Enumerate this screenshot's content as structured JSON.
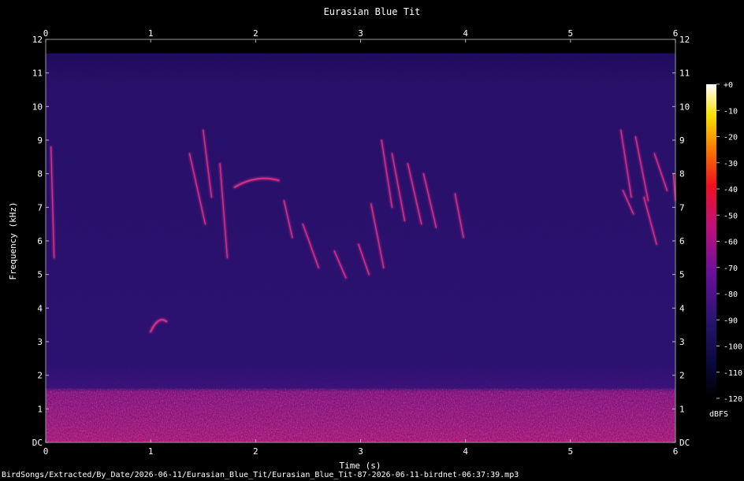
{
  "chart_data": {
    "type": "heatmap",
    "title": "Eurasian Blue Tit",
    "xlabel": "Time (s)",
    "ylabel": "Frequency (kHz)",
    "xlim": [
      0,
      6
    ],
    "ylim": [
      0,
      12
    ],
    "x_ticks": [
      "0",
      "1",
      "2",
      "3",
      "4",
      "5",
      "6"
    ],
    "y_ticks": [
      "DC",
      "1",
      "2",
      "3",
      "4",
      "5",
      "6",
      "7",
      "8",
      "9",
      "10",
      "11",
      "12"
    ],
    "colorbar": {
      "label": "dBFS",
      "range": [
        -120,
        0
      ],
      "ticks": [
        "+0",
        "-10",
        "-20",
        "-30",
        "-40",
        "-50",
        "-60",
        "-70",
        "-80",
        "-90",
        "-100",
        "-110",
        "-120"
      ]
    },
    "colors": {
      "background": "#000000",
      "noise_floor": "#2a1470",
      "low_band": "#c0207a",
      "call": "#e0308a"
    },
    "low_band_khz": [
      0,
      1.6
    ],
    "calls": [
      {
        "t0": 0.05,
        "t1": 0.08,
        "f0": 8.8,
        "f1": 5.5
      },
      {
        "t0": 1.0,
        "t1": 1.15,
        "f0": 3.3,
        "f1": 3.6
      },
      {
        "t0": 1.37,
        "t1": 1.52,
        "f0": 8.6,
        "f1": 6.5
      },
      {
        "t0": 1.5,
        "t1": 1.58,
        "f0": 9.3,
        "f1": 7.3
      },
      {
        "t0": 1.66,
        "t1": 1.73,
        "f0": 8.3,
        "f1": 5.5
      },
      {
        "t0": 1.8,
        "t1": 2.22,
        "f0": 7.6,
        "f1": 7.8
      },
      {
        "t0": 2.27,
        "t1": 2.35,
        "f0": 7.2,
        "f1": 6.1
      },
      {
        "t0": 2.45,
        "t1": 2.6,
        "f0": 6.5,
        "f1": 5.2
      },
      {
        "t0": 2.75,
        "t1": 2.86,
        "f0": 5.7,
        "f1": 4.9
      },
      {
        "t0": 2.98,
        "t1": 3.08,
        "f0": 5.9,
        "f1": 5.0
      },
      {
        "t0": 3.1,
        "t1": 3.22,
        "f0": 7.1,
        "f1": 5.2
      },
      {
        "t0": 3.2,
        "t1": 3.3,
        "f0": 9.0,
        "f1": 7.0
      },
      {
        "t0": 3.3,
        "t1": 3.42,
        "f0": 8.6,
        "f1": 6.6
      },
      {
        "t0": 3.45,
        "t1": 3.58,
        "f0": 8.3,
        "f1": 6.5
      },
      {
        "t0": 3.6,
        "t1": 3.72,
        "f0": 8.0,
        "f1": 6.4
      },
      {
        "t0": 3.9,
        "t1": 3.98,
        "f0": 7.4,
        "f1": 6.1
      },
      {
        "t0": 5.48,
        "t1": 5.58,
        "f0": 9.3,
        "f1": 7.3
      },
      {
        "t0": 5.5,
        "t1": 5.6,
        "f0": 7.5,
        "f1": 6.8
      },
      {
        "t0": 5.62,
        "t1": 5.74,
        "f0": 9.1,
        "f1": 7.2
      },
      {
        "t0": 5.7,
        "t1": 5.82,
        "f0": 7.3,
        "f1": 5.9
      },
      {
        "t0": 5.8,
        "t1": 5.92,
        "f0": 8.6,
        "f1": 7.5
      },
      {
        "t0": 5.98,
        "t1": 6.0,
        "f0": 8.0,
        "f1": 7.2
      }
    ]
  },
  "footer": {
    "filepath": "BirdSongs/Extracted/By_Date/2026-06-11/Eurasian_Blue_Tit/Eurasian_Blue_Tit-87-2026-06-11-birdnet-06:37:39.mp3"
  }
}
